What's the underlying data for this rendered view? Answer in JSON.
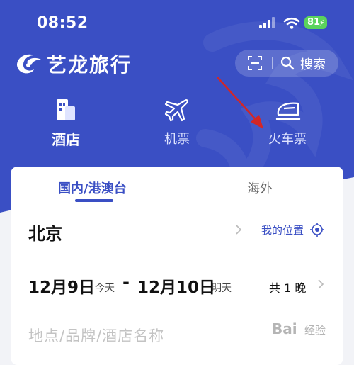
{
  "status_bar": {
    "time": "08:52",
    "battery": "81"
  },
  "header": {
    "brand": "艺龙旅行",
    "search_label": "搜索"
  },
  "nav": {
    "items": [
      {
        "label": "酒店",
        "icon": "hotel-icon",
        "active": true
      },
      {
        "label": "机票",
        "icon": "airplane-icon",
        "active": false
      },
      {
        "label": "火车票",
        "icon": "train-icon",
        "active": false
      }
    ]
  },
  "booking": {
    "tabs": [
      {
        "label": "国内/港澳台",
        "active": true
      },
      {
        "label": "海外",
        "active": false
      }
    ],
    "city": "北京",
    "my_location": "我的位置",
    "checkin_date": "12月9日",
    "checkin_day": "今天",
    "checkout_date": "12月10日",
    "checkout_day": "明天",
    "nights": "共 1 晚",
    "keyword_placeholder": "地点/品牌/酒店名称"
  },
  "watermark": {
    "text": "Bai",
    "sub": "经验"
  },
  "colors": {
    "brand_blue": "#3a4fc4",
    "arrow_red": "#d32626",
    "battery_green": "#5ad35c"
  }
}
